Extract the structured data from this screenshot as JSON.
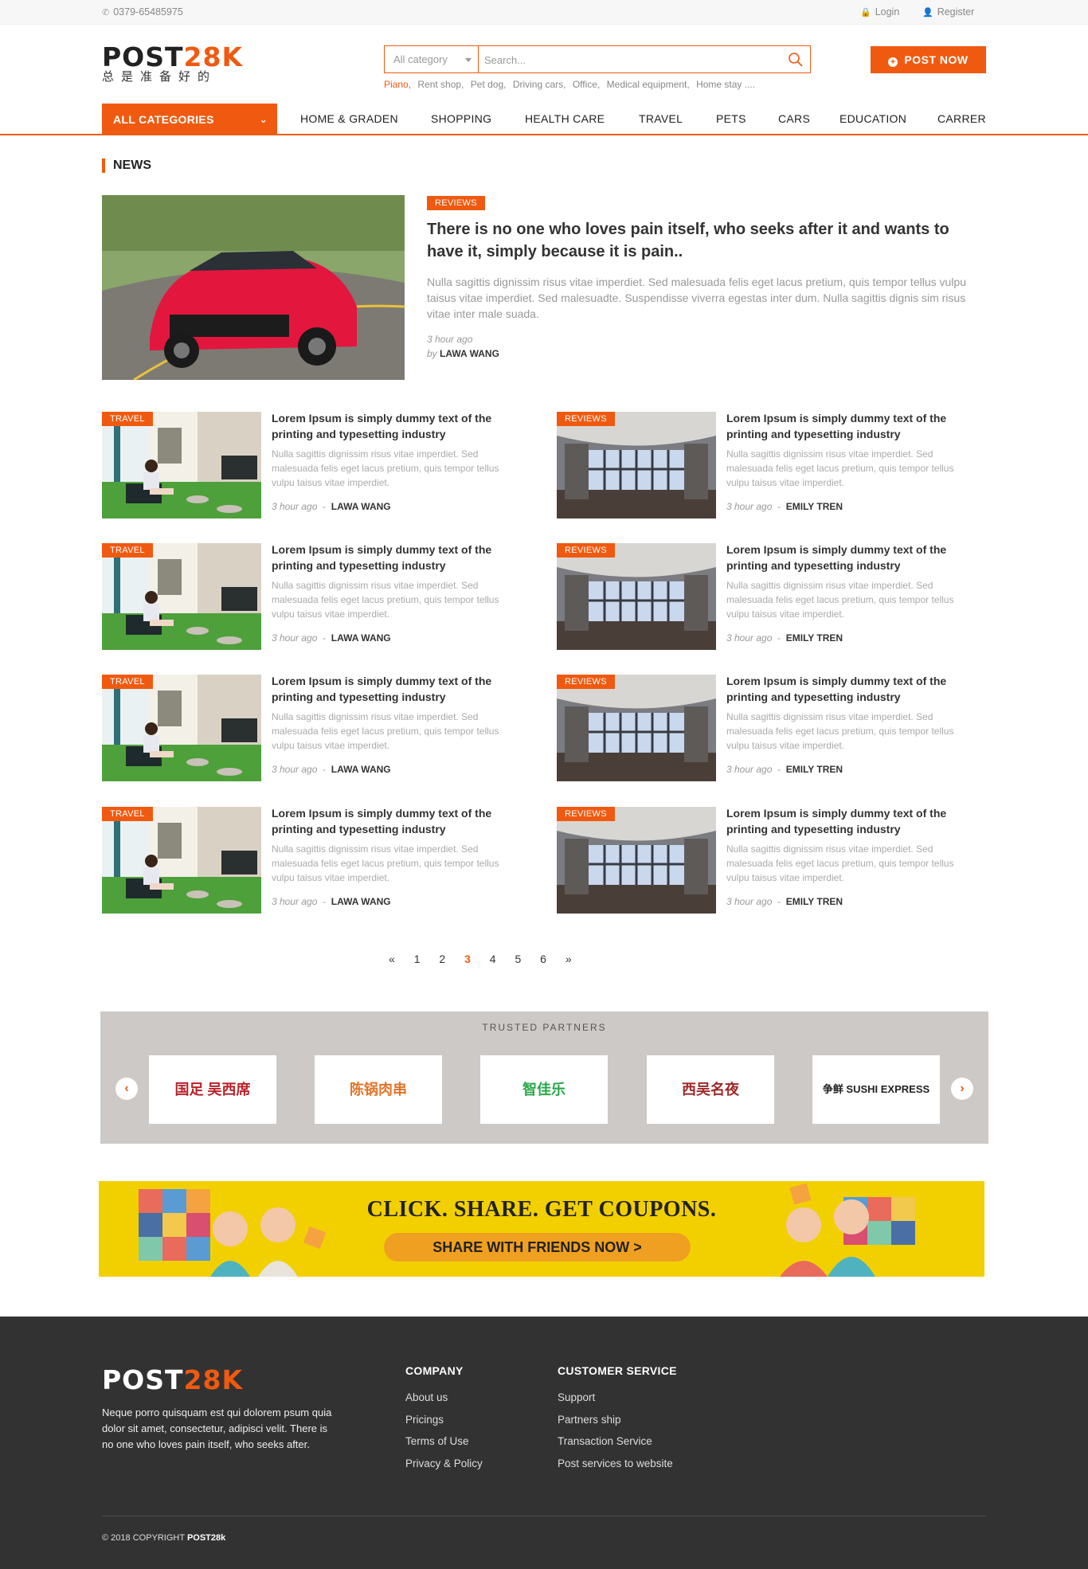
{
  "topbar": {
    "phone": "0379-65485975",
    "login": "Login",
    "register": "Register"
  },
  "logo": {
    "main": "POST",
    "accent": "28K",
    "tagline": "总是准备好的"
  },
  "search": {
    "category": "All category",
    "placeholder": "Search..."
  },
  "popular_tags": [
    "Piano,",
    "Rent shop,",
    "Pet dog,",
    "Driving cars,",
    "Office,",
    "Medical equipment,",
    "Home stay ...."
  ],
  "post_now": "POST NOW",
  "nav": {
    "all_categories": "ALL CATEGORIES",
    "items": [
      "HOME & GRADEN",
      "SHOPPING",
      "HEALTH CARE",
      "TRAVEL",
      "PETS",
      "CARS",
      "EDUCATION",
      "CARRER"
    ]
  },
  "news": {
    "section_title": "NEWS",
    "featured": {
      "badge": "REVIEWS",
      "title": "There is no one who loves pain itself, who seeks after it and wants to have it, simply because it is pain..",
      "description": "Nulla sagittis dignissim risus vitae imperdiet. Sed malesuada felis eget lacus pretium, quis tempor tellus vulpu taisus vitae imperdiet. Sed malesuadte. Suspendisse viverra egestas inter dum. Nulla sagittis dignis sim risus vitae inter male suada.",
      "time": "3 hour ago",
      "by": "by",
      "author": "LAWA WANG"
    },
    "items": [
      {
        "badge": "TRAVEL",
        "title": "Lorem Ipsum is simply dummy text of the printing and typesetting industry",
        "desc": "Nulla sagittis dignissim risus vitae imperdiet. Sed malesuada felis eget lacus pretium, quis tempor tellus vulpu taisus vitae imperdiet.",
        "time": "3 hour ago",
        "author": "LAWA WANG"
      },
      {
        "badge": "REVIEWS",
        "title": "Lorem Ipsum is simply dummy text of the printing and typesetting industry",
        "desc": "Nulla sagittis dignissim risus vitae imperdiet. Sed malesuada felis eget lacus pretium, quis tempor tellus vulpu taisus vitae imperdiet.",
        "time": "3 hour ago",
        "author": "EMILY TREN"
      },
      {
        "badge": "TRAVEL",
        "title": "Lorem Ipsum is simply dummy text of the printing and typesetting industry",
        "desc": "Nulla sagittis dignissim risus vitae imperdiet. Sed malesuada felis eget lacus pretium, quis tempor tellus vulpu taisus vitae imperdiet.",
        "time": "3 hour ago",
        "author": "LAWA WANG"
      },
      {
        "badge": "REVIEWS",
        "title": "Lorem Ipsum is simply dummy text of the printing and typesetting industry",
        "desc": "Nulla sagittis dignissim risus vitae imperdiet. Sed malesuada felis eget lacus pretium, quis tempor tellus vulpu taisus vitae imperdiet.",
        "time": "3 hour ago",
        "author": "EMILY TREN"
      },
      {
        "badge": "TRAVEL",
        "title": "Lorem Ipsum is simply dummy text of the printing and typesetting industry",
        "desc": "Nulla sagittis dignissim risus vitae imperdiet. Sed malesuada felis eget lacus pretium, quis tempor tellus vulpu taisus vitae imperdiet.",
        "time": "3 hour ago",
        "author": "LAWA WANG"
      },
      {
        "badge": "REVIEWS",
        "title": "Lorem Ipsum is simply dummy text of the printing and typesetting industry",
        "desc": "Nulla sagittis dignissim risus vitae imperdiet. Sed malesuada felis eget lacus pretium, quis tempor tellus vulpu taisus vitae imperdiet.",
        "time": "3 hour ago",
        "author": "EMILY TREN"
      },
      {
        "badge": "TRAVEL",
        "title": "Lorem Ipsum is simply dummy text of the printing and typesetting industry",
        "desc": "Nulla sagittis dignissim risus vitae imperdiet. Sed malesuada felis eget lacus pretium, quis tempor tellus vulpu taisus vitae imperdiet.",
        "time": "3 hour ago",
        "author": "LAWA WANG"
      },
      {
        "badge": "REVIEWS",
        "title": "Lorem Ipsum is simply dummy text of the printing and typesetting industry",
        "desc": "Nulla sagittis dignissim risus vitae imperdiet. Sed malesuada felis eget lacus pretium, quis tempor tellus vulpu taisus vitae imperdiet.",
        "time": "3 hour ago",
        "author": "EMILY TREN"
      }
    ]
  },
  "pagination": {
    "prev": "«",
    "pages": [
      "1",
      "2",
      "3",
      "4",
      "5",
      "6"
    ],
    "current": "3",
    "next": "»"
  },
  "partners": {
    "title": "TRUSTED PARTNERS",
    "logos": [
      "国足 吴西席",
      "陈锅肉串",
      "智佳乐",
      "西吴名夜",
      "争鲜 SUSHI EXPRESS"
    ]
  },
  "banner": {
    "headline": "CLICK. SHARE. GET COUPONS.",
    "button": "SHARE WITH FRIENDS NOW >"
  },
  "footer": {
    "logo_main": "POST",
    "logo_accent": "28K",
    "description": "Neque porro quisquam est qui dolorem psum quia dolor sit amet, consectetur, adipisci velit. There is no one who loves pain itself, who seeks after.",
    "company": {
      "title": "COMPANY",
      "links": [
        "About us",
        "Pricings",
        "Terms of Use",
        "Privacy & Policy"
      ]
    },
    "customer_service": {
      "title": "CUSTOMER SERVICE",
      "links": [
        "Support",
        "Partners ship",
        "Transaction Service",
        "Post services to website"
      ]
    },
    "copyright": "© 2018 COPYRIGHT",
    "copyright_brand": "POST28k"
  },
  "colors": {
    "accent": "#f05a10",
    "footer_bg": "#323232",
    "partners_bg": "#cdc9c6",
    "banner_bg": "#f2d000"
  }
}
